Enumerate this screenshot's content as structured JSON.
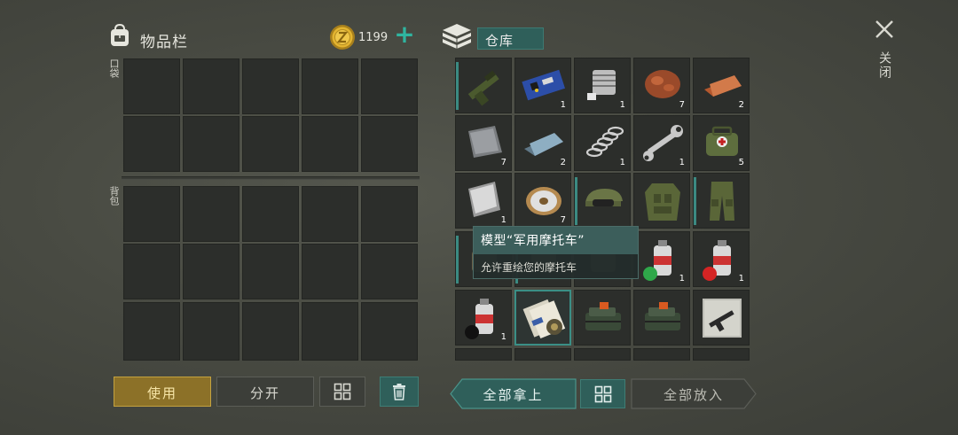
{
  "inventory": {
    "title": "物品栏",
    "pocket_label": "口袋",
    "backpack_label": "背包",
    "coins": "1199",
    "add_coins": "+"
  },
  "storage": {
    "title": "仓库",
    "items": [
      {
        "icon": "grenade-launcher-icon",
        "qty": ""
      },
      {
        "icon": "circuit-board-icon",
        "qty": "1"
      },
      {
        "icon": "engine-cylinder-icon",
        "qty": "1"
      },
      {
        "icon": "copper-ore-icon",
        "qty": "7"
      },
      {
        "icon": "copper-ingot-icon",
        "qty": "2"
      },
      {
        "icon": "iron-plate-icon",
        "qty": "7"
      },
      {
        "icon": "steel-ingot-icon",
        "qty": "2"
      },
      {
        "icon": "spring-icon",
        "qty": "1"
      },
      {
        "icon": "wrench-icon",
        "qty": "1"
      },
      {
        "icon": "medical-bag-icon",
        "qty": "5"
      },
      {
        "icon": "aluminum-sheet-icon",
        "qty": "1"
      },
      {
        "icon": "wire-spool-icon",
        "qty": "7"
      },
      {
        "icon": "military-cap-icon",
        "qty": ""
      },
      {
        "icon": "body-armor-icon",
        "qty": ""
      },
      {
        "icon": "military-pants-icon",
        "qty": ""
      },
      {
        "icon": "hidden-item-icon",
        "qty": ""
      },
      {
        "icon": "hidden-item-icon",
        "qty": ""
      },
      {
        "icon": "hidden-item-icon",
        "qty": ""
      },
      {
        "icon": "green-spray-paint-icon",
        "qty": "1"
      },
      {
        "icon": "red-spray-paint-icon",
        "qty": "1"
      },
      {
        "icon": "black-spray-paint-icon",
        "qty": "1"
      },
      {
        "icon": "motorcycle-blueprint-icon",
        "qty": ""
      },
      {
        "icon": "explosive-charge-icon",
        "qty": ""
      },
      {
        "icon": "explosive-charge-icon",
        "qty": ""
      },
      {
        "icon": "rifle-blueprint-icon",
        "qty": ""
      }
    ]
  },
  "tooltip": {
    "title": "模型“军用摩托车”",
    "description": "允许重绘您的摩托车"
  },
  "close": {
    "label": "关闭"
  },
  "buttons": {
    "use": "使用",
    "split": "分开",
    "take_all": "全部拿上",
    "put_all": "全部放入"
  },
  "colors": {
    "accent_teal": "#2f5f5a",
    "use_gold": "#8c7128",
    "coin_gold": "#d9a929"
  }
}
